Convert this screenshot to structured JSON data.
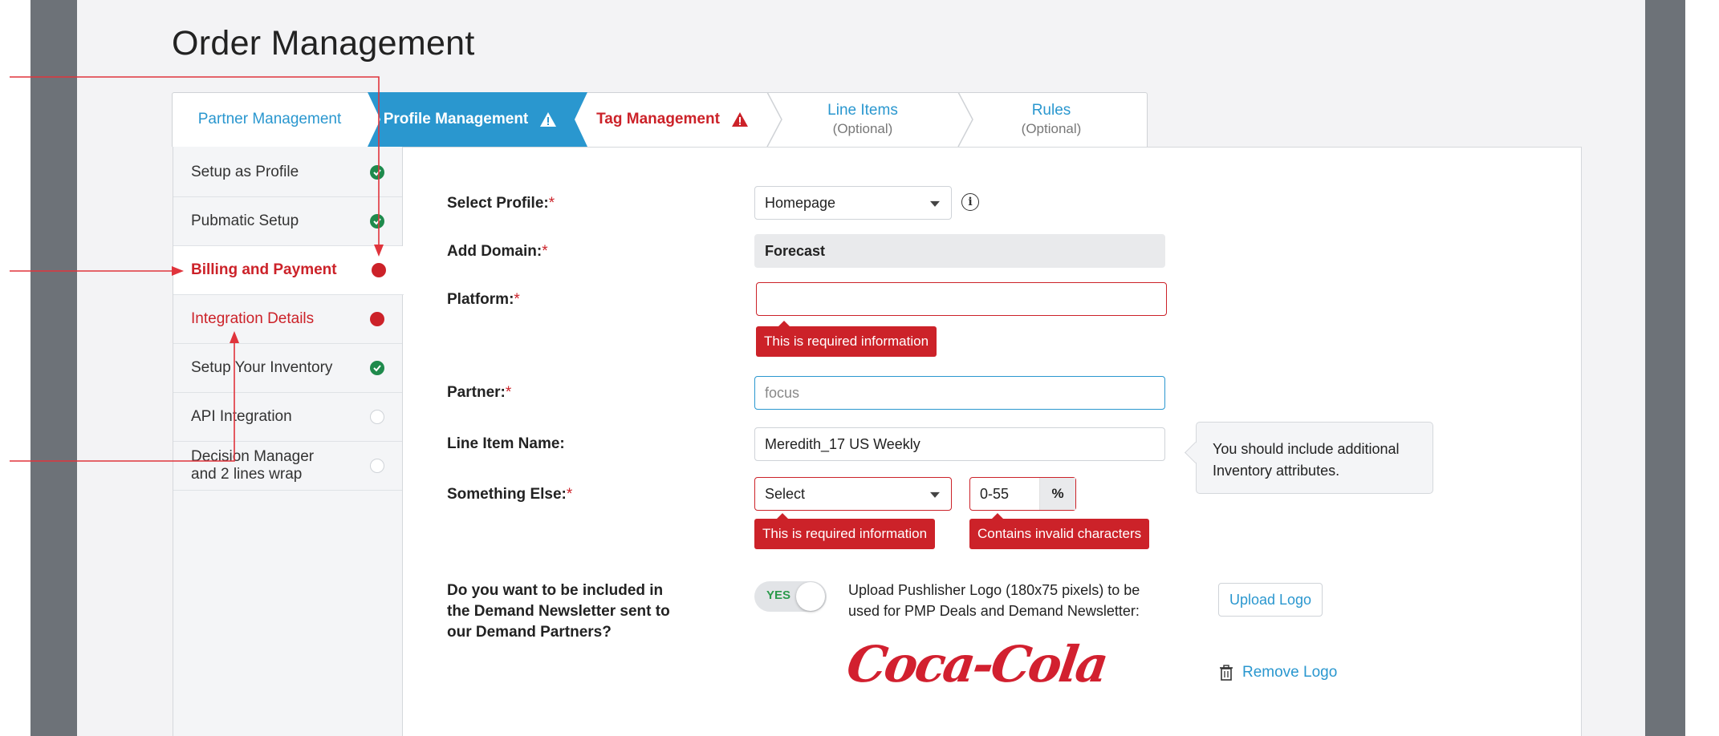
{
  "page": {
    "title": "Order Management"
  },
  "tabs": [
    {
      "label": "Partner Management",
      "sub": ""
    },
    {
      "label": "Profile Management",
      "sub": ""
    },
    {
      "label": "Tag Management",
      "sub": ""
    },
    {
      "label": "Line Items",
      "sub": "(Optional)"
    },
    {
      "label": "Rules",
      "sub": "(Optional)"
    }
  ],
  "sidebar": {
    "items": [
      {
        "label": "Setup as Profile",
        "status": "complete"
      },
      {
        "label": "Pubmatic Setup",
        "status": "complete"
      },
      {
        "label": "Billing and Payment",
        "status": "error"
      },
      {
        "label": "Integration Details",
        "status": "error"
      },
      {
        "label": "Setup Your Inventory",
        "status": "complete"
      },
      {
        "label": "API Integration",
        "status": "empty"
      },
      {
        "label": "Decision Manager",
        "label2": "and 2 lines wrap",
        "status": "empty"
      }
    ]
  },
  "form": {
    "select_profile": {
      "label": "Select Profile:",
      "required": "*",
      "value": "Homepage"
    },
    "add_domain": {
      "label": "Add Domain:",
      "required": "*",
      "value": "Forecast"
    },
    "platform": {
      "label": "Platform:",
      "required": "*",
      "value": "",
      "error": "This is required information"
    },
    "partner": {
      "label": "Partner:",
      "required": "*",
      "value": "focus"
    },
    "line_item_name": {
      "label": "Line Item Name:",
      "value": "Meredith_17 US Weekly",
      "hint": "You should include additional Inventory attributes."
    },
    "something_else": {
      "label": "Something Else:",
      "required": "*",
      "select_value": "Select",
      "select_error": "This is required information",
      "range_value": "0-55",
      "range_unit": "%",
      "range_error": "Contains invalid characters"
    },
    "newsletter": {
      "question_line1": "Do you want to be included in",
      "question_line2": "the Demand Newsletter sent to",
      "question_line3": "our Demand Partners?",
      "toggle_label": "YES",
      "toggle_on": true
    },
    "logo": {
      "upload_text_line1": "Upload Pushlisher Logo (180x75 pixels) to be",
      "upload_text_line2": "used for PMP Deals and Demand Newsletter:",
      "upload_button": "Upload Logo",
      "remove_link": "Remove Logo",
      "logo_text": "Coca-Cola"
    }
  },
  "colors": {
    "accent": "#2a97cf",
    "error": "#cc2229",
    "success": "#1f8a4c",
    "frame": "#6d7278"
  }
}
